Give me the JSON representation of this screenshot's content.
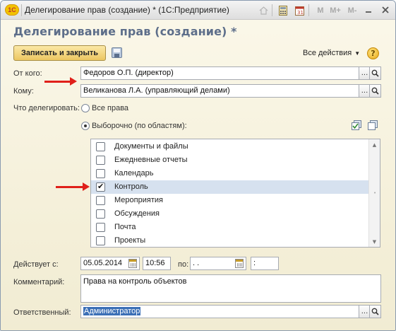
{
  "window": {
    "title": "Делегирование прав (создание) * (1С:Предприятие)",
    "logo_text": "1С",
    "memory_buttons": [
      "M",
      "M+",
      "M-"
    ]
  },
  "form": {
    "title": "Делегирование прав (создание) *",
    "save_close_label": "Записать и закрыть",
    "all_actions_label": "Все действия",
    "help_label": "?"
  },
  "fields": {
    "from_label": "От кого:",
    "from_value": "Федоров О.П. (директор)",
    "to_label": "Кому:",
    "to_value": "Великанова Л.А. (управляющий делами)",
    "what_label": "Что делегировать:",
    "radio_all_label": "Все права",
    "radio_selective_label": "Выборочно (по областям):",
    "valid_from_label": "Действует с:",
    "valid_from_date": "05.05.2014",
    "valid_from_time": "10:56",
    "valid_to_label": "по:",
    "valid_to_date": " .  .",
    "valid_to_time": ":",
    "comment_label": "Комментарий:",
    "comment_value": "Права на контроль объектов",
    "responsible_label": "Ответственный:",
    "responsible_value": "Администратор",
    "more_button": "...",
    "open_button_icon": "magnifier-icon"
  },
  "areas": [
    {
      "label": "Документы и файлы",
      "checked": false
    },
    {
      "label": "Ежедневные отчеты",
      "checked": false
    },
    {
      "label": "Календарь",
      "checked": false
    },
    {
      "label": "Контроль",
      "checked": true
    },
    {
      "label": "Мероприятия",
      "checked": false
    },
    {
      "label": "Обсуждения",
      "checked": false
    },
    {
      "label": "Почта",
      "checked": false
    },
    {
      "label": "Проекты",
      "checked": false
    }
  ],
  "colors": {
    "accent_title": "#5d6e8a",
    "highlight_arrow": "#e0201a",
    "selected_row": "#d6e1ef",
    "save_button": "#ecc661"
  }
}
